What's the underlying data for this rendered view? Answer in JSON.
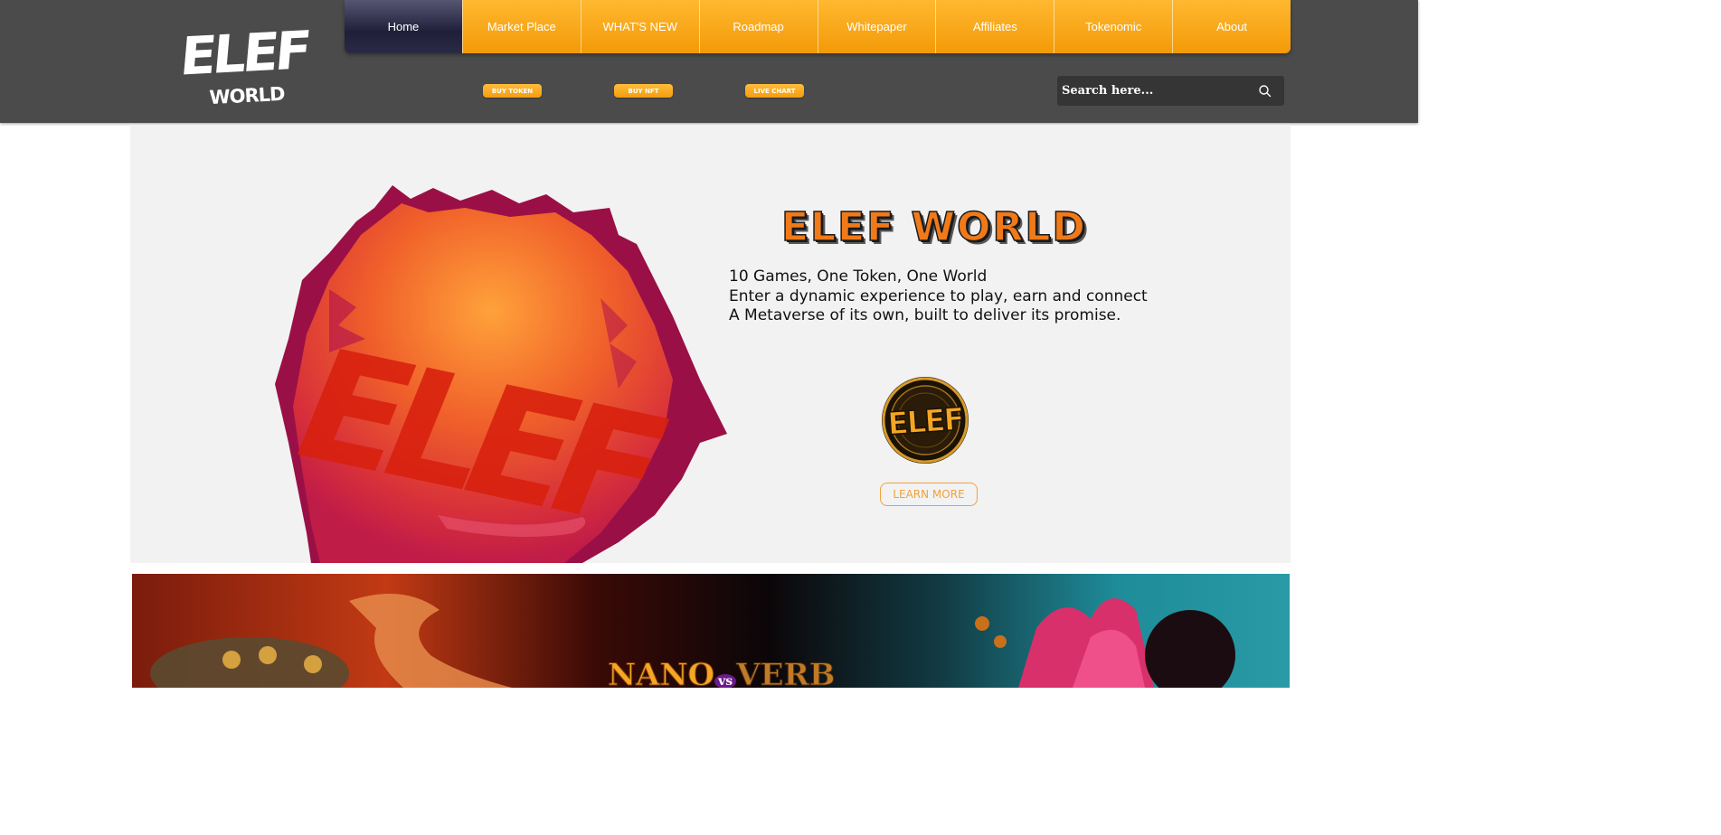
{
  "brand": {
    "logo_top": "ELEF",
    "logo_bottom": "WORLD"
  },
  "nav": {
    "items": [
      {
        "label": "Home"
      },
      {
        "label": "Market Place"
      },
      {
        "label": "WHAT'S NEW"
      },
      {
        "label": "Roadmap"
      },
      {
        "label": "Whitepaper"
      },
      {
        "label": "Affiliates"
      },
      {
        "label": "Tokenomic"
      },
      {
        "label": "About"
      }
    ],
    "active": "Home"
  },
  "actions": {
    "buy_token": "BUY TOKEN",
    "buy_nft": "BUY NFT",
    "live_chart": "LIVE CHART"
  },
  "search": {
    "placeholder": "Search here..."
  },
  "hero": {
    "title": "ELEF WORLD",
    "art_text": "ELEF",
    "lines": [
      "10 Games, One Token, One World",
      "Enter a dynamic experience to play, earn and connect",
      "A Metaverse of its own, built to deliver its promise."
    ],
    "coin_text": "ELEF",
    "cta": "LEARN MORE"
  },
  "banner": {
    "title_left": "NANO",
    "title_vs": "vs",
    "title_right": "VERB"
  },
  "colors": {
    "accent": "#f59c10",
    "header_bg": "#4b4b4b",
    "hero_bg": "#f2f2f2",
    "active_nav": "#1f1f3a"
  }
}
